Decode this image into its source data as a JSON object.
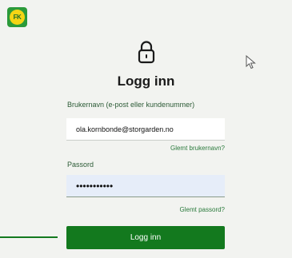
{
  "logo": {
    "text": "FK",
    "accent": "#f4d515",
    "brand": "#2b9a3a"
  },
  "title": "Logg inn",
  "username": {
    "label": "Brukernavn (e-post eller kundenummer)",
    "value": "ola.kornbonde@storgarden.no",
    "forgot_link": "Glemt brukernavn?"
  },
  "password": {
    "label": "Passord",
    "value": "•••••••••••",
    "forgot_link": "Glemt passord?"
  },
  "submit_button": "Logg inn",
  "colors": {
    "button": "#13791e",
    "link": "#2a7a3c",
    "background": "#f2f3f0"
  },
  "icons": {
    "lock": "lock-icon",
    "cursor": "mouse-pointer-icon"
  }
}
